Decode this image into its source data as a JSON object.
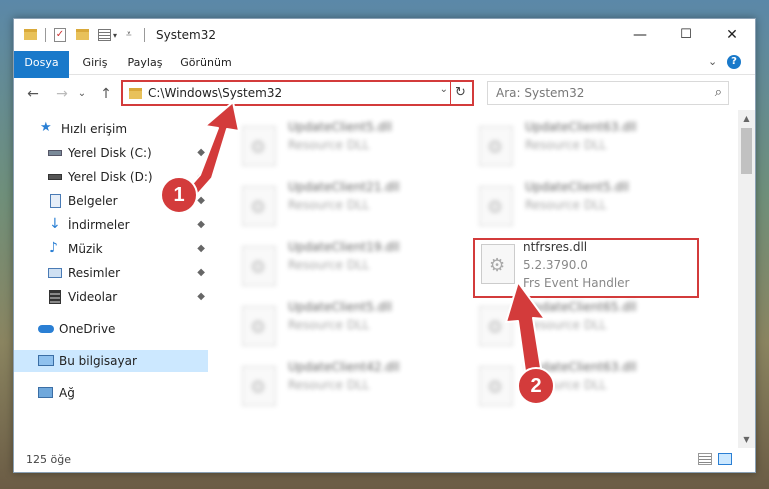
{
  "window": {
    "title": "System32",
    "minimize": "—",
    "maximize": "☐",
    "close": "✕"
  },
  "ribbon": {
    "tabs": [
      "Dosya",
      "Giriş",
      "Paylaş",
      "Görünüm"
    ],
    "chevron": "⌄",
    "help": "?"
  },
  "address": {
    "path": "C:\\Windows\\System32",
    "back": "←",
    "forward": "→",
    "recent": "⌄",
    "up": "↑",
    "dropdown": "⌄",
    "refresh": "↻"
  },
  "search": {
    "placeholder": "Ara: System32",
    "icon": "⌕"
  },
  "nav": {
    "items": [
      {
        "label": "Hızlı erişim",
        "icon": "star-icon",
        "pinned": false
      },
      {
        "label": "Yerel Disk (C:)",
        "icon": "drive-icon",
        "pinned": true
      },
      {
        "label": "Yerel Disk (D:)",
        "icon": "drive-icon",
        "pinned": true
      },
      {
        "label": "Belgeler",
        "icon": "documents-icon",
        "pinned": true
      },
      {
        "label": "İndirmeler",
        "icon": "downloads-icon",
        "pinned": true
      },
      {
        "label": "Müzik",
        "icon": "music-icon",
        "pinned": true
      },
      {
        "label": "Resimler",
        "icon": "pictures-icon",
        "pinned": true
      },
      {
        "label": "Videolar",
        "icon": "videos-icon",
        "pinned": true
      },
      {
        "label": "OneDrive",
        "icon": "cloud-icon",
        "pinned": false
      },
      {
        "label": "Bu bilgisayar",
        "icon": "computer-icon",
        "pinned": false,
        "selected": true
      },
      {
        "label": "Ağ",
        "icon": "network-icon",
        "pinned": false
      }
    ],
    "pin_glyph": "📌"
  },
  "files": [
    {
      "name": "UpdateClient5.dll",
      "type": "Resource DLL",
      "blurred": true
    },
    {
      "name": "UpdateClient63.dll",
      "type": "Resource DLL",
      "blurred": true
    },
    {
      "name": "UpdateClient21.dll",
      "type": "Resource DLL",
      "blurred": true
    },
    {
      "name": "UpdateClient5.dll",
      "type": "Resource DLL",
      "blurred": true
    },
    {
      "name": "UpdateClient19.dll",
      "type": "Resource DLL",
      "blurred": true
    },
    {
      "name": "ntfrsres.dll",
      "version": "5.2.3790.0",
      "type": "Frs Event Handler",
      "blurred": false,
      "highlighted": true
    },
    {
      "name": "UpdateClient5.dll",
      "type": "Resource DLL",
      "blurred": true
    },
    {
      "name": "UpdateClient65.dll",
      "type": "Resource DLL",
      "blurred": true
    },
    {
      "name": "UpdateClient42.dll",
      "type": "Resource DLL",
      "blurred": true
    },
    {
      "name": "UpdateClient63.dll",
      "type": "Resource DLL",
      "blurred": true
    }
  ],
  "status": {
    "count": "125 öğe"
  },
  "annotations": {
    "badge1": "1",
    "badge2": "2",
    "color": "#d33b3b"
  }
}
